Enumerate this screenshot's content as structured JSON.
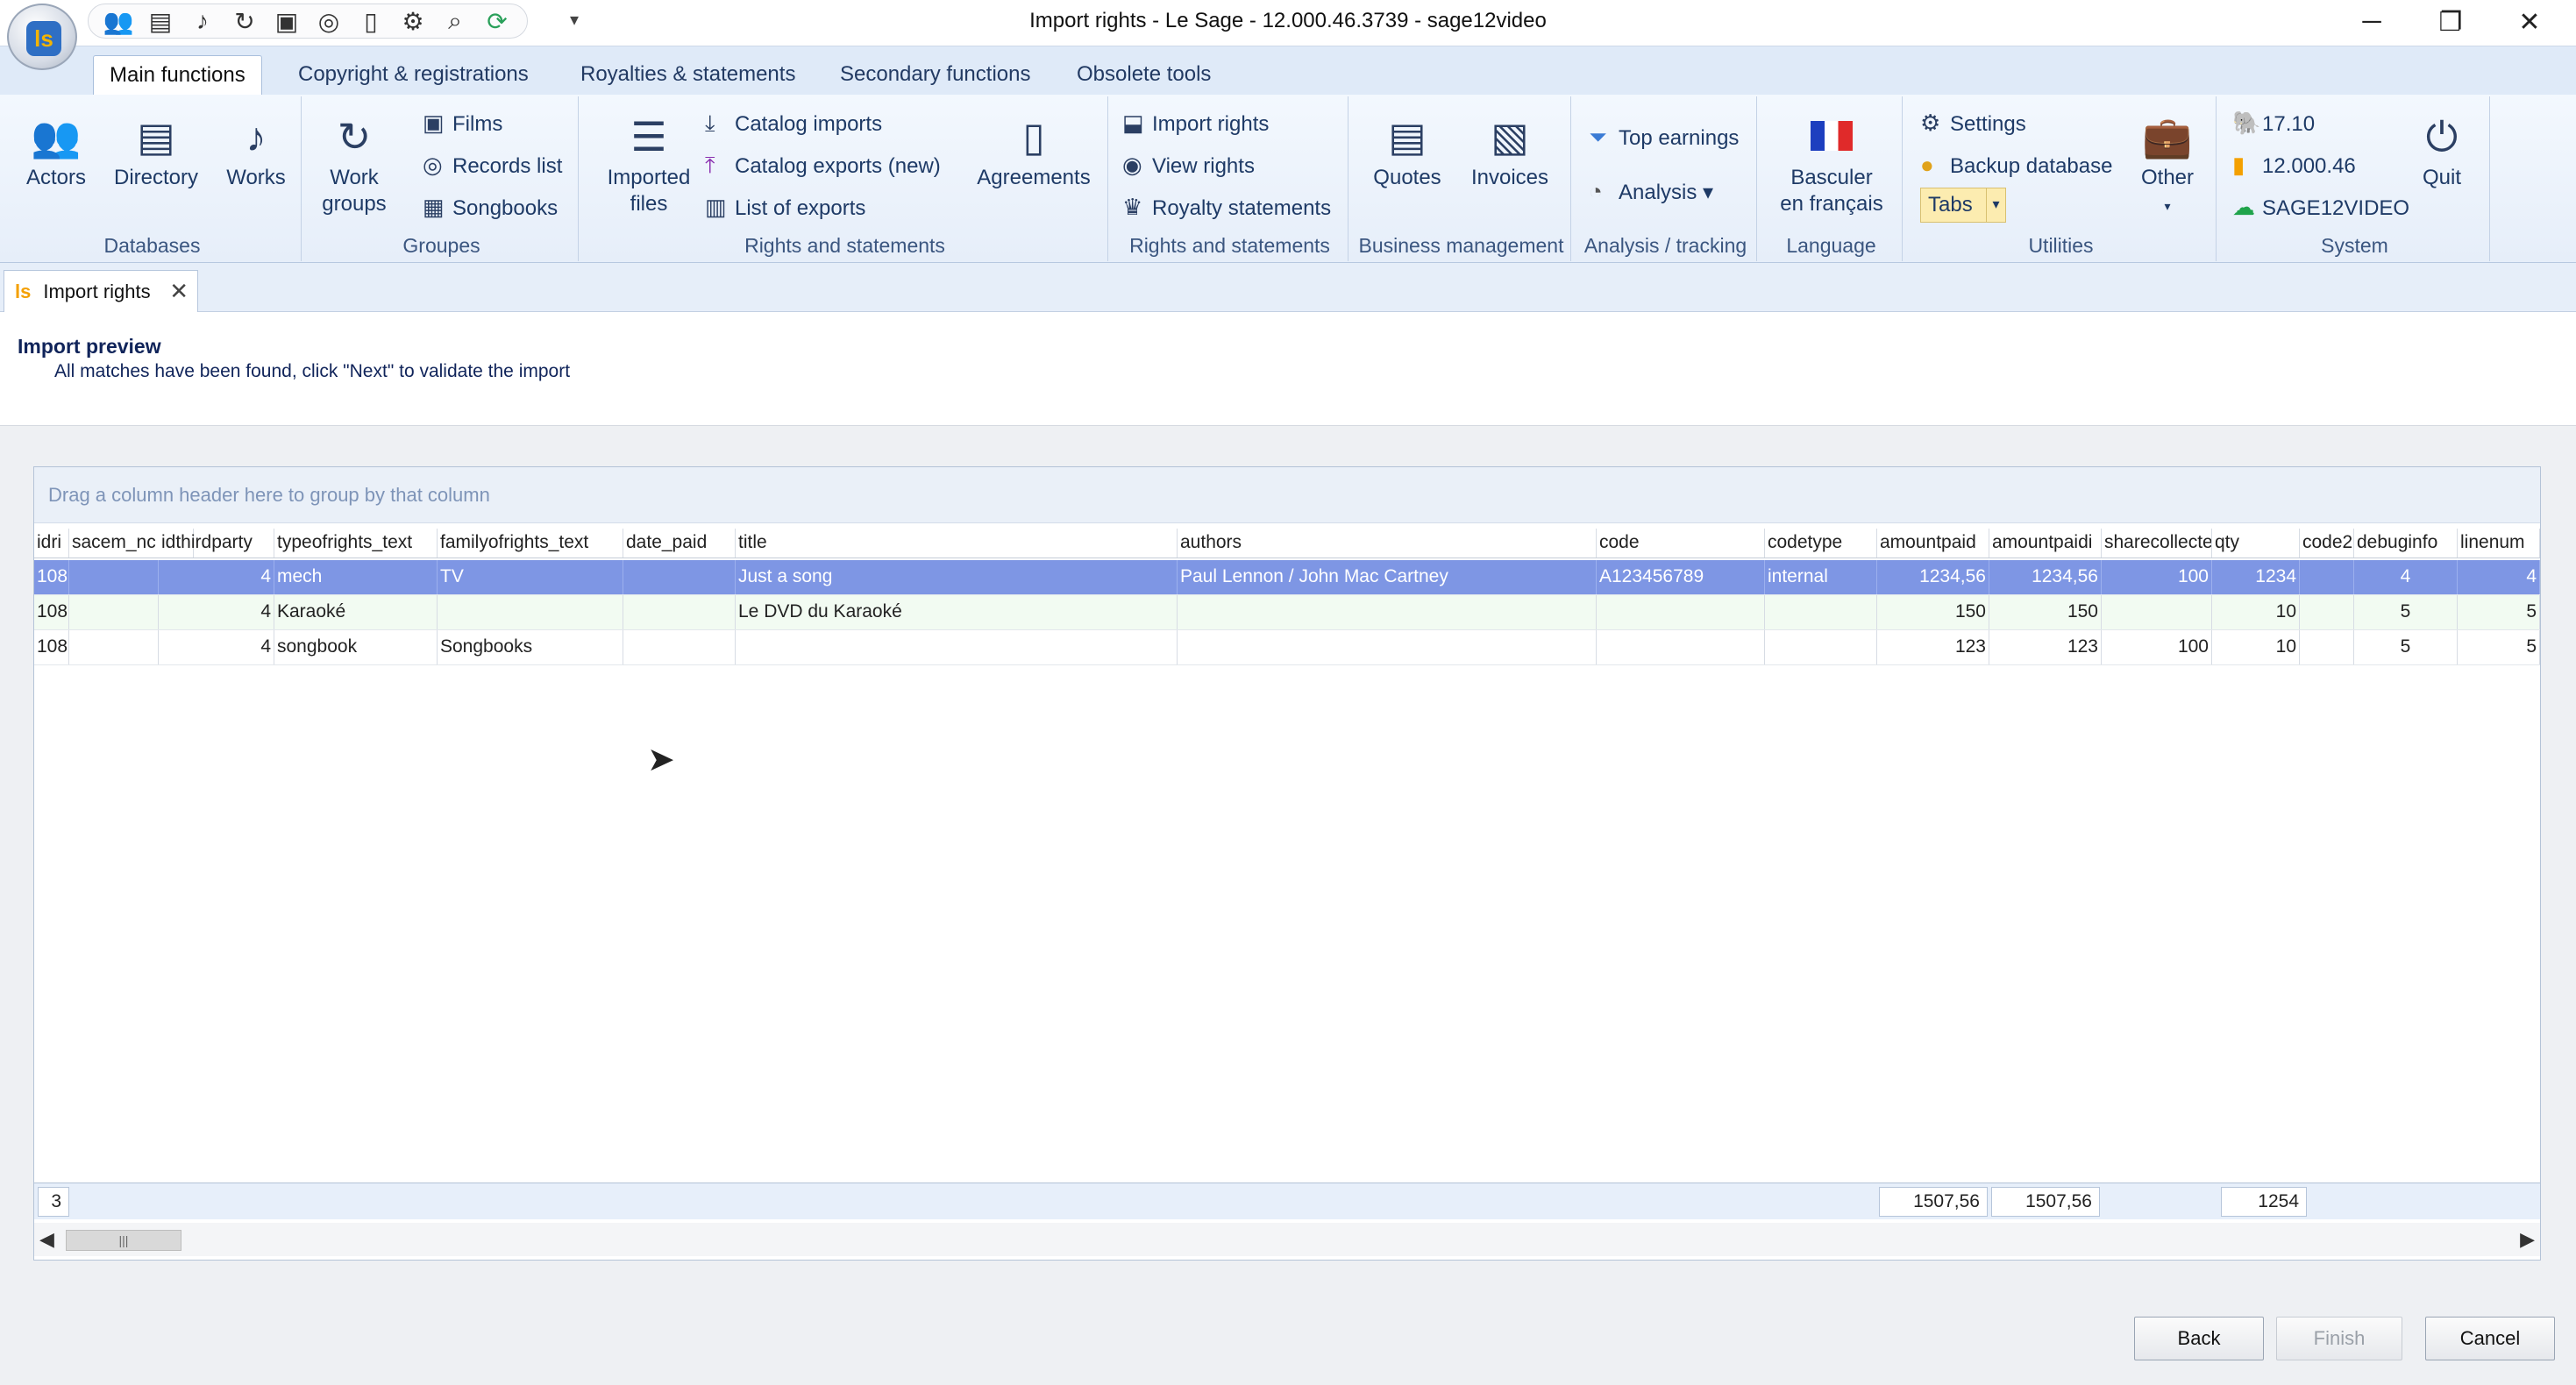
{
  "window": {
    "title": "Import rights - Le Sage - 12.000.46.3739  - sage12video",
    "minimize": "─",
    "restore": "❐",
    "close": "✕"
  },
  "app": {
    "logo": "ls"
  },
  "qat": {
    "icons": [
      "actors-icon",
      "directory-icon",
      "works-icon",
      "work-groups-icon",
      "films-icon",
      "records-icon",
      "agreements-icon",
      "settings-icon",
      "search-icon",
      "refresh-icon"
    ],
    "more": "▾"
  },
  "ribbon_tabs": [
    "Main functions",
    "Copyright & registrations",
    "Royalties & statements",
    "Secondary functions",
    "Obsolete tools"
  ],
  "ribbon": {
    "databases": {
      "label": "Databases",
      "actors": "Actors",
      "directory": "Directory",
      "works": "Works"
    },
    "groupes": {
      "label": "Groupes",
      "work_groups_1": "Work",
      "work_groups_2": "groups",
      "films": "Films",
      "records": "Records list",
      "songbooks": "Songbooks"
    },
    "rights1": {
      "label": "Rights and statements",
      "imported_1": "Imported",
      "imported_2": "files",
      "catalog_imports": "Catalog imports",
      "catalog_exports": "Catalog exports (new)",
      "list_exports": "List of exports",
      "agreements": "Agreements"
    },
    "rights2": {
      "label": "Rights and statements",
      "import_rights": "Import rights",
      "view_rights": "View rights",
      "royalty_statements": "Royalty statements"
    },
    "business": {
      "label": "Business management",
      "quotes": "Quotes",
      "invoices": "Invoices"
    },
    "analysis": {
      "label": "Analysis / tracking",
      "top_earnings": "Top earnings",
      "analysis": "Analysis"
    },
    "language": {
      "label": "Language",
      "basculer_1": "Basculer",
      "basculer_2": "en français"
    },
    "utilities": {
      "label": "Utilities",
      "settings": "Settings",
      "backup": "Backup database",
      "tabs": "Tabs",
      "other": "Other"
    },
    "system": {
      "label": "System",
      "pg_version": "17.10",
      "app_version": "12.000.46",
      "db_name": "SAGE12VIDEO",
      "quit": "Quit"
    }
  },
  "doc_tab": {
    "label": "Import rights",
    "close": "✕"
  },
  "preview": {
    "title": "Import preview",
    "message": "All matches have been found, click \"Next\" to validate the import"
  },
  "grid": {
    "group_hint": "Drag a column header here to group by that column",
    "columns": [
      "idri",
      "sacem_nc",
      "idthirdparty",
      "typeofrights_text",
      "familyofrights_text",
      "date_paid",
      "title",
      "authors",
      "code",
      "codetype",
      "amountpaid",
      "amountpaidi",
      "sharecollecte",
      "qty",
      "code2",
      "debuginfo",
      "linenum"
    ],
    "rows": [
      [
        "108",
        "",
        "4",
        "mech",
        "TV",
        "",
        "Just a song",
        "Paul Lennon / John Mac Cartney",
        "A123456789",
        "internal",
        "1234,56",
        "1234,56",
        "100",
        "1234",
        "",
        "4",
        "4"
      ],
      [
        "108",
        "",
        "4",
        "Karaoké",
        "",
        "",
        "Le DVD du Karaoké",
        "",
        "",
        "",
        "150",
        "150",
        "",
        "10",
        "",
        "5",
        "5"
      ],
      [
        "108",
        "",
        "4",
        "songbook",
        "Songbooks",
        "",
        "",
        "",
        "",
        "",
        "123",
        "123",
        "100",
        "10",
        "",
        "5",
        "5"
      ]
    ],
    "footer": {
      "count": "3",
      "amountpaid": "1507,56",
      "amountpaidi": "1507,56",
      "qty": "1254"
    }
  },
  "buttons": {
    "back": "Back",
    "finish": "Finish",
    "cancel": "Cancel"
  }
}
